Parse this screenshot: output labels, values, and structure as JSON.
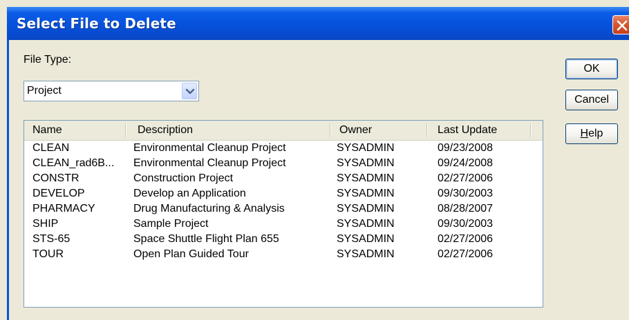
{
  "dialog": {
    "title": "Select File to Delete",
    "file_type_label": "File Type:",
    "file_type_value": "Project"
  },
  "buttons": {
    "ok": "OK",
    "cancel": "Cancel",
    "help": "Help"
  },
  "list": {
    "columns": [
      "Name",
      "Description",
      "Owner",
      "Last Update"
    ],
    "rows": [
      {
        "name": "CLEAN",
        "description": "Environmental Cleanup Project",
        "owner": "SYSADMIN",
        "last_update": "09/23/2008"
      },
      {
        "name": "CLEAN_rad6B...",
        "description": "Environmental Cleanup Project",
        "owner": "SYSADMIN",
        "last_update": "09/24/2008"
      },
      {
        "name": "CONSTR",
        "description": "Construction Project",
        "owner": "SYSADMIN",
        "last_update": "02/27/2006"
      },
      {
        "name": "DEVELOP",
        "description": "Develop an Application",
        "owner": "SYSADMIN",
        "last_update": "09/30/2003"
      },
      {
        "name": "PHARMACY",
        "description": "Drug Manufacturing & Analysis",
        "owner": "SYSADMIN",
        "last_update": "08/28/2007"
      },
      {
        "name": "SHIP",
        "description": "Sample Project",
        "owner": "SYSADMIN",
        "last_update": "09/30/2003"
      },
      {
        "name": "STS-65",
        "description": "Space Shuttle Flight Plan 655",
        "owner": "SYSADMIN",
        "last_update": "02/27/2006"
      },
      {
        "name": "TOUR",
        "description": "Open Plan Guided Tour",
        "owner": "SYSADMIN",
        "last_update": "02/27/2006"
      }
    ]
  },
  "icons": {
    "close": "close-icon",
    "dropdown": "chevron-down-icon"
  },
  "colors": {
    "titlebar": "#0651dc",
    "close_button": "#d9552c",
    "dialog_background": "#ece9d8"
  }
}
